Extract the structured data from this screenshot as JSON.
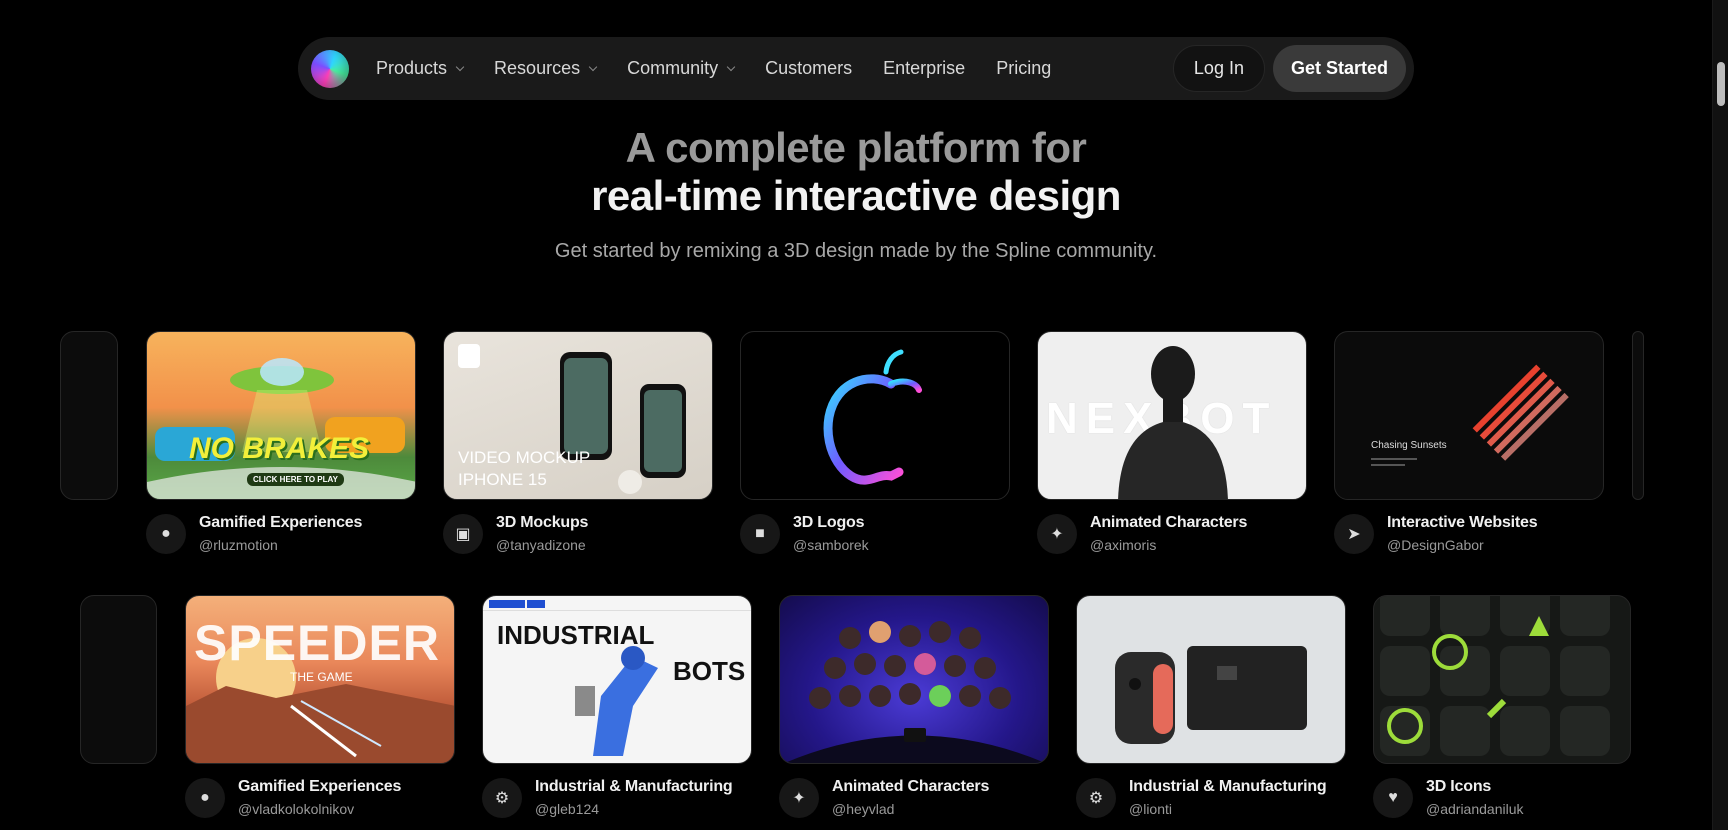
{
  "nav": {
    "items": [
      {
        "label": "Products",
        "dropdown": true
      },
      {
        "label": "Resources",
        "dropdown": true
      },
      {
        "label": "Community",
        "dropdown": true
      },
      {
        "label": "Customers",
        "dropdown": false
      },
      {
        "label": "Enterprise",
        "dropdown": false
      },
      {
        "label": "Pricing",
        "dropdown": false
      }
    ],
    "login_label": "Log In",
    "cta_label": "Get Started"
  },
  "hero": {
    "title_line1": "A complete platform for",
    "title_line2": "real-time interactive design",
    "subtitle": "Get started by remixing a 3D design made by the Spline community."
  },
  "row1": [
    {
      "category": "Gamified Experiences",
      "author": "@rluzmotion",
      "icon": "joystick-icon",
      "art": "art-nobrakes",
      "thumb_text": "NO BRAKES",
      "thumb_sub": "CLICK HERE TO PLAY"
    },
    {
      "category": "3D Mockups",
      "author": "@tanyadizone",
      "icon": "laptop-icon",
      "art": "art-mockup",
      "thumb_text": "VIDEO MOCKUP",
      "thumb_sub": "IPHONE 15"
    },
    {
      "category": "3D Logos",
      "author": "@samborek",
      "icon": "cube-icon",
      "art": "art-logo",
      "thumb_text": "",
      "thumb_sub": ""
    },
    {
      "category": "Animated Characters",
      "author": "@aximoris",
      "icon": "bunny-icon",
      "art": "art-nexbot",
      "thumb_text": "NEXBOT",
      "thumb_sub": ""
    },
    {
      "category": "Interactive Websites",
      "author": "@DesignGabor",
      "icon": "cursor-icon",
      "art": "art-sunsets",
      "thumb_text": "Chasing Sunsets",
      "thumb_sub": ""
    }
  ],
  "row2": [
    {
      "category": "Gamified Experiences",
      "author": "@vladkolokolnikov",
      "icon": "joystick-icon",
      "art": "art-speeder",
      "thumb_text": "SPEEDER",
      "thumb_sub": "THE GAME"
    },
    {
      "category": "Industrial & Manufacturing",
      "author": "@gleb124",
      "icon": "gear-icon",
      "art": "art-industrial",
      "thumb_text": "INDUSTRIAL",
      "thumb_sub": "BOTS"
    },
    {
      "category": "Animated Characters",
      "author": "@heyvlad",
      "icon": "bunny-icon",
      "art": "art-animated",
      "thumb_text": "",
      "thumb_sub": ""
    },
    {
      "category": "Industrial & Manufacturing",
      "author": "@lionti",
      "icon": "gear-icon",
      "art": "art-switch",
      "thumb_text": "",
      "thumb_sub": ""
    },
    {
      "category": "3D Icons",
      "author": "@adriandaniluk",
      "icon": "heart-icon",
      "art": "art-icons",
      "thumb_text": "",
      "thumb_sub": ""
    }
  ]
}
